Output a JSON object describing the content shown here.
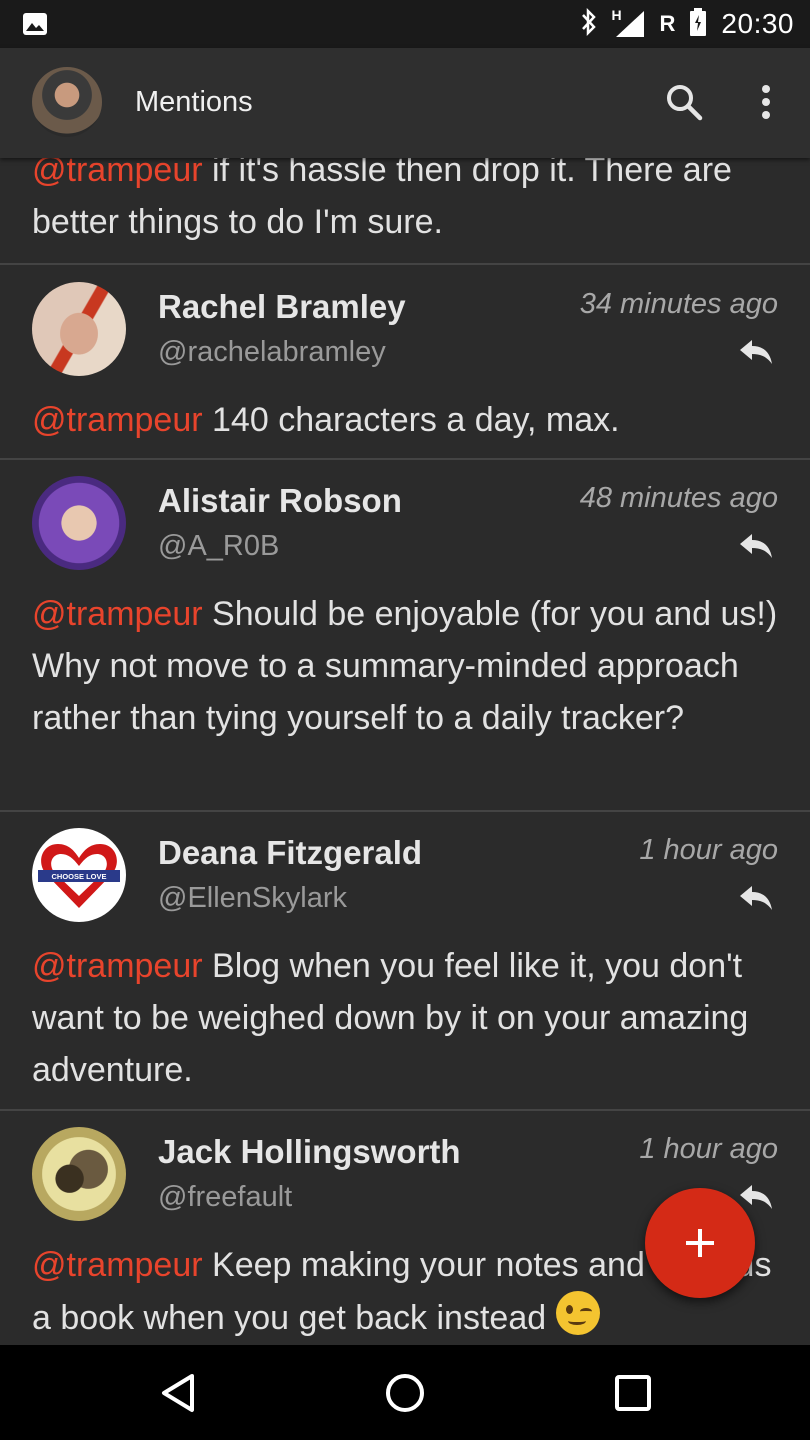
{
  "status_bar": {
    "time": "20:30",
    "roaming": "R",
    "network": "H",
    "icons": [
      "image-icon",
      "bluetooth-icon",
      "signal-icon",
      "battery-icon"
    ]
  },
  "app_bar": {
    "title": "Mentions",
    "icons": [
      "search-icon",
      "more-vert-icon"
    ]
  },
  "tweets": [
    {
      "mention": "@trampeur",
      "text": " if it's hassle then drop it. There are better things to do I'm sure."
    },
    {
      "name": "Rachel Bramley",
      "handle": "@rachelabramley",
      "time": "34 minutes ago",
      "mention": "@trampeur",
      "text": " 140 characters a day, max."
    },
    {
      "name": "Alistair Robson",
      "handle": "@A_R0B",
      "time": "48 minutes ago",
      "mention": "@trampeur",
      "text": " Should be enjoyable (for you and us!) Why not move to a summary-minded approach rather than tying yourself to a daily tracker?"
    },
    {
      "name": "Deana Fitzgerald",
      "handle": "@EllenSkylark",
      "time": "1 hour ago",
      "avatar_text": "CHOOSE LOVE",
      "mention": "@trampeur",
      "text": " Blog when you feel like it, you don't want to be weighed down by it on your amazing adventure."
    },
    {
      "name": "Jack Hollingsworth",
      "handle": "@freefault",
      "time": "1 hour ago",
      "mention": "@trampeur",
      "text": " Keep making your notes and write us a book when you get back instead"
    }
  ],
  "fab": {
    "icon": "plus-icon"
  },
  "nav_bar": {
    "icons": [
      "back-icon",
      "home-icon",
      "recents-icon"
    ]
  },
  "colors": {
    "accent": "#e8442c",
    "fab": "#d42a16",
    "background": "#2b2b2b",
    "app_bar": "#2f2f2f"
  }
}
